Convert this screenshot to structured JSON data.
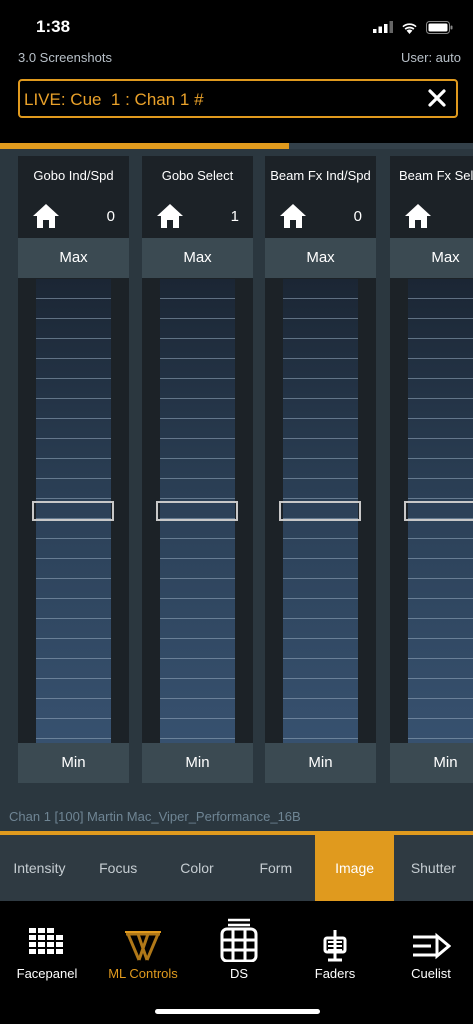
{
  "status_bar": {
    "time": "1:38"
  },
  "header": {
    "show_name": "3.0 Screenshots",
    "user": "User: auto"
  },
  "command_line": {
    "text": "LIVE: Cue  1 : Chan 1 #"
  },
  "progress": {
    "fraction": 0.61
  },
  "faders": [
    {
      "title": "Gobo Ind/Spd",
      "value": "0",
      "max_label": "Max",
      "min_label": "Min",
      "level": 0.5
    },
    {
      "title": "Gobo Select",
      "value": "1",
      "max_label": "Max",
      "min_label": "Min",
      "level": 0.5
    },
    {
      "title": "Beam Fx Ind/Spd",
      "value": "0",
      "max_label": "Max",
      "min_label": "Min",
      "level": 0.5
    },
    {
      "title": "Beam Fx Select",
      "value": "",
      "max_label": "Max",
      "min_label": "Min",
      "level": 0.5
    }
  ],
  "info_line": "Chan 1  [100] Martin Mac_Viper_Performance_16B",
  "categories": [
    {
      "label": "Intensity",
      "active": false
    },
    {
      "label": "Focus",
      "active": false
    },
    {
      "label": "Color",
      "active": false
    },
    {
      "label": "Form",
      "active": false
    },
    {
      "label": "Image",
      "active": true
    },
    {
      "label": "Shutter",
      "active": false
    }
  ],
  "nav": [
    {
      "label": "Facepanel",
      "icon": "facepanel-icon",
      "active": false
    },
    {
      "label": "ML Controls",
      "icon": "ml-controls-icon",
      "active": true
    },
    {
      "label": "DS",
      "icon": "ds-grid-icon",
      "active": false
    },
    {
      "label": "Faders",
      "icon": "faders-icon",
      "active": false
    },
    {
      "label": "Cuelist",
      "icon": "cuelist-icon",
      "active": false
    }
  ],
  "colors": {
    "accent": "#e09a1e",
    "panel": "#2b373f",
    "fader_bg": "#1c2227"
  }
}
